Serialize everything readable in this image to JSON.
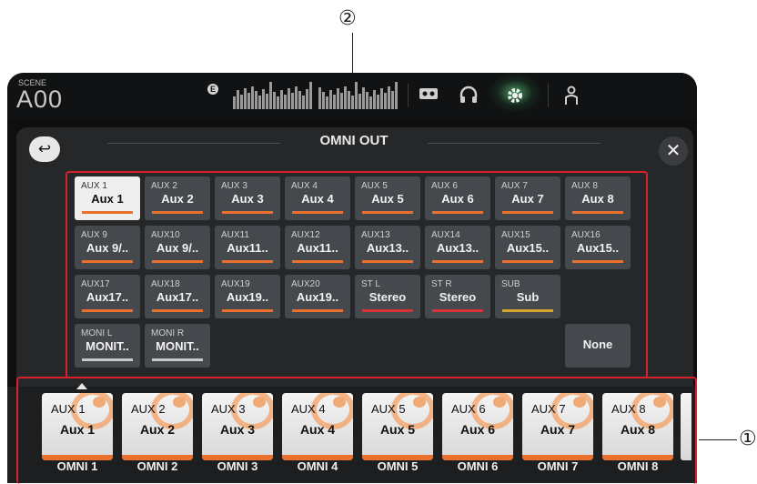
{
  "callouts": {
    "grid_marker": "②",
    "strip_marker": "①"
  },
  "topbar": {
    "scene_label": "SCENE",
    "scene_value": "A00",
    "edit_badge": "E"
  },
  "header": {
    "title": "OMNI OUT",
    "back_icon": "back-arrow-icon",
    "close_label": "✕"
  },
  "colors": {
    "selected_bar": "#e9702d",
    "stereo_bar": "#d9323a",
    "sub_bar": "#d4a52a",
    "monitor_bar": "#c8c8c8",
    "highlight_frame": "#d9212a"
  },
  "grid": {
    "rows": [
      [
        {
          "label": "AUX 1",
          "value": "Aux 1",
          "bar": "orange",
          "selected": true
        },
        {
          "label": "AUX 2",
          "value": "Aux 2",
          "bar": "orange"
        },
        {
          "label": "AUX 3",
          "value": "Aux 3",
          "bar": "orange"
        },
        {
          "label": "AUX 4",
          "value": "Aux 4",
          "bar": "orange"
        },
        {
          "label": "AUX 5",
          "value": "Aux 5",
          "bar": "orange"
        },
        {
          "label": "AUX 6",
          "value": "Aux 6",
          "bar": "orange"
        },
        {
          "label": "AUX 7",
          "value": "Aux 7",
          "bar": "orange"
        },
        {
          "label": "AUX 8",
          "value": "Aux 8",
          "bar": "orange"
        }
      ],
      [
        {
          "label": "AUX 9",
          "value": "Aux 9/..",
          "bar": "orange"
        },
        {
          "label": "AUX10",
          "value": "Aux 9/..",
          "bar": "orange"
        },
        {
          "label": "AUX11",
          "value": "Aux11..",
          "bar": "orange"
        },
        {
          "label": "AUX12",
          "value": "Aux11..",
          "bar": "orange"
        },
        {
          "label": "AUX13",
          "value": "Aux13..",
          "bar": "orange"
        },
        {
          "label": "AUX14",
          "value": "Aux13..",
          "bar": "orange"
        },
        {
          "label": "AUX15",
          "value": "Aux15..",
          "bar": "orange"
        },
        {
          "label": "AUX16",
          "value": "Aux15..",
          "bar": "orange"
        }
      ],
      [
        {
          "label": "AUX17",
          "value": "Aux17..",
          "bar": "orange"
        },
        {
          "label": "AUX18",
          "value": "Aux17..",
          "bar": "orange"
        },
        {
          "label": "AUX19",
          "value": "Aux19..",
          "bar": "orange"
        },
        {
          "label": "AUX20",
          "value": "Aux19..",
          "bar": "orange"
        },
        {
          "label": "ST L",
          "value": "Stereo",
          "bar": "red"
        },
        {
          "label": "ST R",
          "value": "Stereo",
          "bar": "red"
        },
        {
          "label": "SUB",
          "value": "Sub",
          "bar": "yellow"
        }
      ],
      [
        {
          "label": "MONI L",
          "value": "MONIT..",
          "bar": "grey"
        },
        {
          "label": "MONI R",
          "value": "MONIT..",
          "bar": "grey"
        }
      ]
    ],
    "none_label": "None"
  },
  "outputs": [
    {
      "label": "AUX 1",
      "value": "Aux 1",
      "name": "OMNI 1"
    },
    {
      "label": "AUX 2",
      "value": "Aux 2",
      "name": "OMNI 2"
    },
    {
      "label": "AUX 3",
      "value": "Aux 3",
      "name": "OMNI 3"
    },
    {
      "label": "AUX 4",
      "value": "Aux 4",
      "name": "OMNI 4"
    },
    {
      "label": "AUX 5",
      "value": "Aux 5",
      "name": "OMNI 5"
    },
    {
      "label": "AUX 6",
      "value": "Aux 6",
      "name": "OMNI 6"
    },
    {
      "label": "AUX 7",
      "value": "Aux 7",
      "name": "OMNI 7"
    },
    {
      "label": "AUX 8",
      "value": "Aux 8",
      "name": "OMNI 8"
    }
  ],
  "top_icons": [
    "recorder-icon",
    "headphones-icon",
    "gear-icon",
    "user-icon"
  ]
}
